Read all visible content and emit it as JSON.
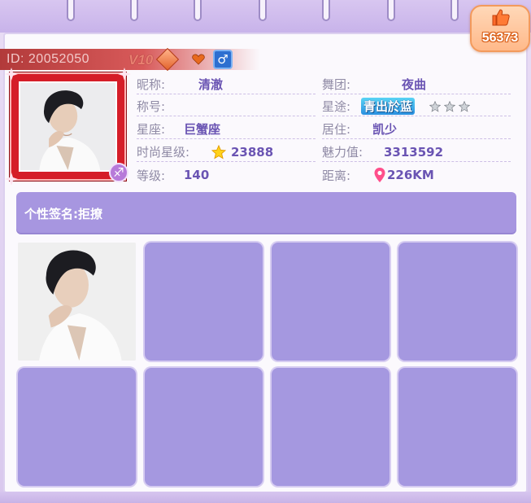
{
  "like": {
    "count": "56373",
    "icon": "thumbs-up-icon"
  },
  "profile": {
    "id_text": "ID: 20052050",
    "vip_text": "V10",
    "gender_icon": "male-symbol-icon",
    "gender_glyph": "♂",
    "zodiac_icon": "sagittarius-icon",
    "zodiac_glyph": "♐"
  },
  "info": {
    "nickname_label": "昵称:",
    "nickname_value": "清澈",
    "title_label": "称号:",
    "title_value": "",
    "constellation_label": "星座:",
    "constellation_value": "巨蟹座",
    "fashion_star_label": "时尚星级:",
    "fashion_star_value": "23888",
    "level_label": "等级:",
    "level_value": "140",
    "dance_group_label": "舞团:",
    "dance_group_value": "夜曲",
    "star_path_label": "星途:",
    "star_path_value": "青出於蓝",
    "residence_label": "居住:",
    "residence_value": "凯少",
    "charm_label": "魅力值:",
    "charm_value": "3313592",
    "distance_label": "距离:",
    "distance_value": "226KM"
  },
  "signature": {
    "label": "个性签名:",
    "text": "拒撩"
  },
  "colors": {
    "accent_purple": "#a796e0",
    "value_text": "#6a54b3",
    "label_text": "#8f8aa5",
    "id_bar": "#b23a3a",
    "like_badge": "#ffb98a"
  }
}
